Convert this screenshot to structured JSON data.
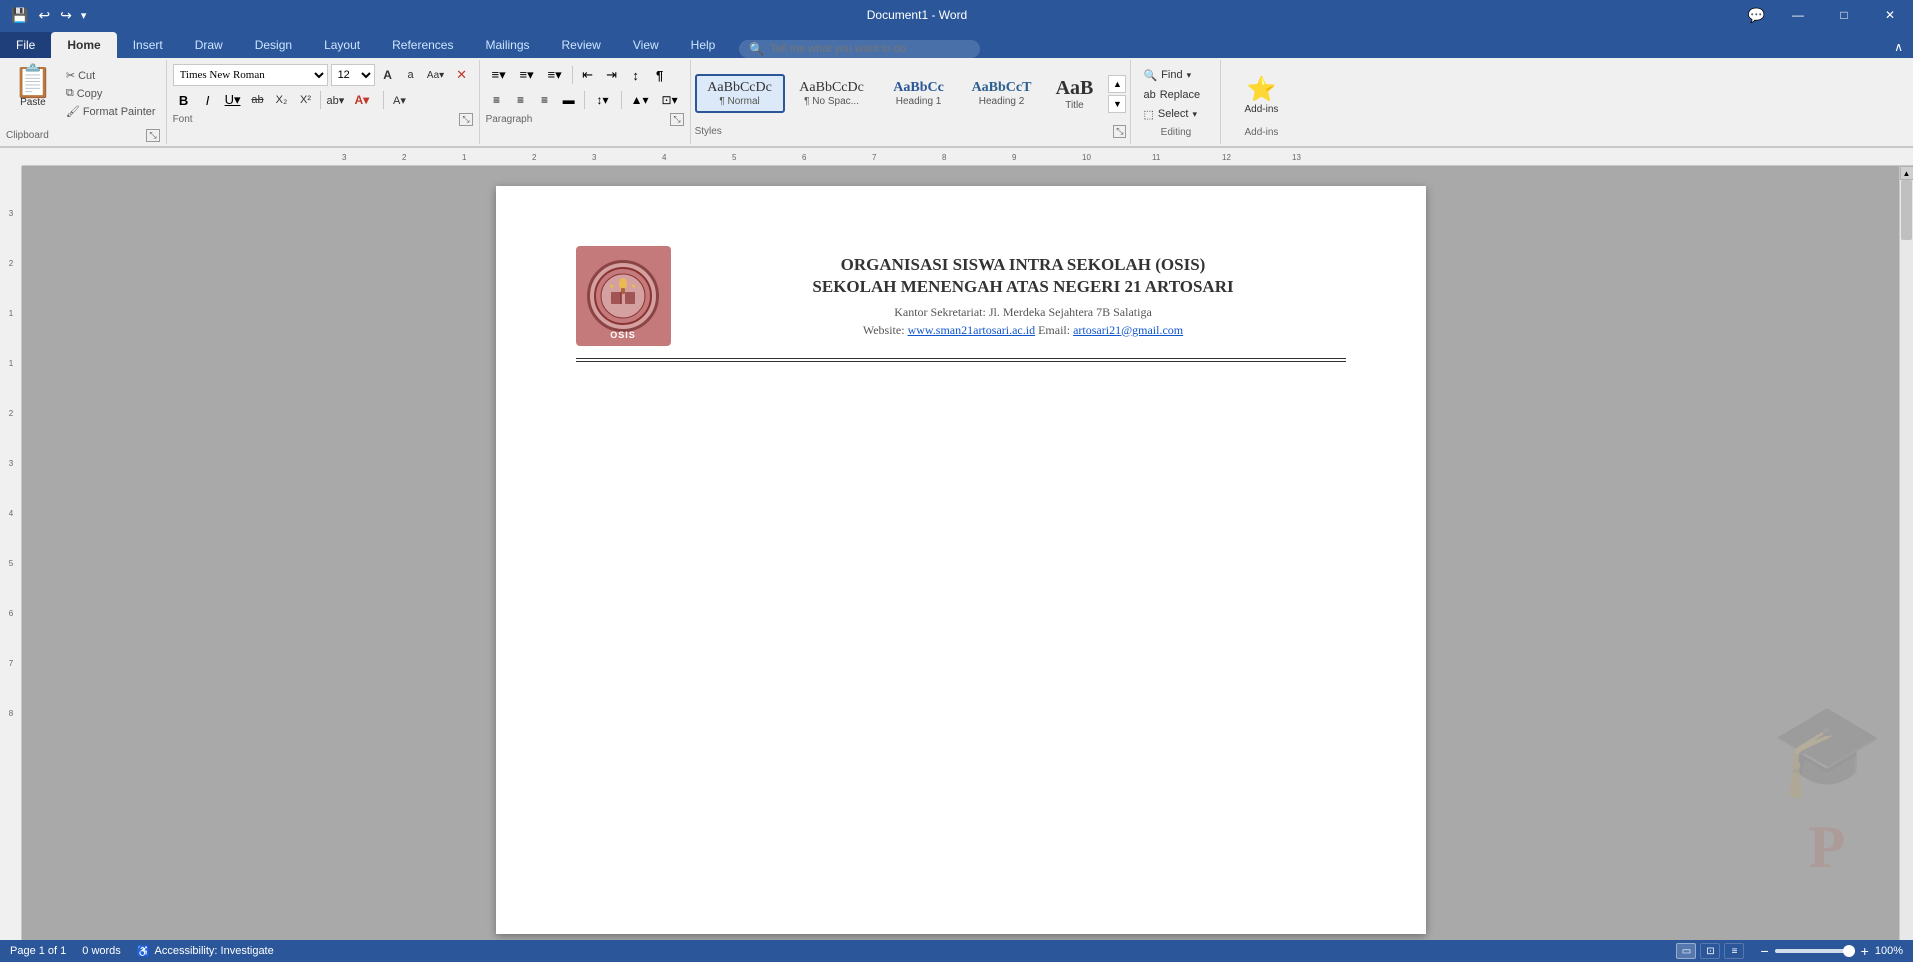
{
  "app": {
    "title": "Document1 - Word",
    "file_tab": "File",
    "tabs": [
      "Home",
      "Insert",
      "Draw",
      "Design",
      "Layout",
      "References",
      "Mailings",
      "Review",
      "View",
      "Help"
    ],
    "active_tab": "Home",
    "search_placeholder": "Tell me what you want to do",
    "collapse_icon": "∧"
  },
  "qat": {
    "save_icon": "💾",
    "undo_icon": "↩",
    "redo_icon": "↪",
    "customize_icon": "▾"
  },
  "clipboard": {
    "label": "Clipboard",
    "paste_label": "Paste",
    "cut_label": "Cut",
    "copy_label": "Copy",
    "format_painter_label": "Format Painter"
  },
  "font": {
    "label": "Font",
    "name": "Times New Roman",
    "size": "12",
    "grow_label": "A",
    "shrink_label": "a",
    "case_label": "Aa",
    "clear_label": "✕",
    "bold_label": "B",
    "italic_label": "I",
    "underline_label": "U",
    "strikethrough_label": "ab",
    "subscript_label": "X₂",
    "superscript_label": "X²",
    "font_color_label": "A",
    "highlight_label": "ab",
    "text_color_label": "A"
  },
  "paragraph": {
    "label": "Paragraph"
  },
  "styles": {
    "label": "Styles",
    "items": [
      {
        "id": "normal",
        "preview": "¶ Normal",
        "label": "Normal",
        "active": true
      },
      {
        "id": "no-spacing",
        "preview": "¶ No Spac...",
        "label": "No Spacing",
        "active": false
      },
      {
        "id": "heading1",
        "preview": "Heading 1",
        "label": "Heading 1",
        "active": false
      },
      {
        "id": "heading2",
        "preview": "Heading 2",
        "label": "Heading 2",
        "active": false
      },
      {
        "id": "title",
        "preview": "Title",
        "label": "Title",
        "active": false
      }
    ]
  },
  "editing": {
    "label": "Editing",
    "find_label": "Find",
    "replace_label": "Replace",
    "select_label": "Select"
  },
  "addins": {
    "label": "Add-ins",
    "addins_label": "Add-ins",
    "icon": "⭐"
  },
  "document": {
    "logo_text": "OSIS",
    "org_line1": "ORGANISASI SISWA INTRA SEKOLAH (OSIS)",
    "org_line2": "SEKOLAH MENENGAH ATAS NEGERI 21 ARTOSARI",
    "address": "Kantor Sekretariat: Jl. Merdeka Sejahtera 7B Salatiga",
    "website_label": "Website:",
    "website_url": "www.sman21artosari.ac.id",
    "email_label": "Email:",
    "email_address": "artosari21@gmail.com"
  },
  "status": {
    "page": "Page 1 of 1",
    "words": "0 words",
    "accessibility": "Accessibility: Investigate",
    "zoom": "100%"
  },
  "window": {
    "minimize": "—",
    "maximize": "□",
    "close": "✕",
    "chat_icon": "💬"
  }
}
